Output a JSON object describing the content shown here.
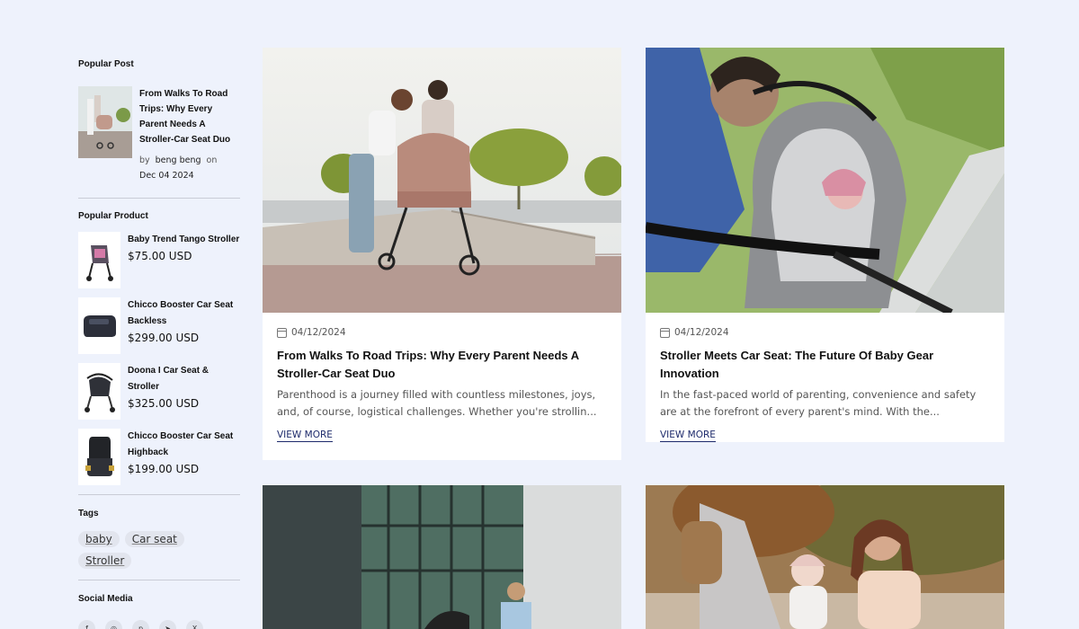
{
  "sidebar": {
    "popular_post": {
      "heading": "Popular Post",
      "item": {
        "title": "From Walks To Road Trips: Why Every Parent Needs A Stroller-Car Seat Duo",
        "by": "by",
        "author": "beng beng",
        "on": "on",
        "date": "Dec 04 2024"
      }
    },
    "popular_product": {
      "heading": "Popular Product",
      "items": [
        {
          "name": "Baby Trend Tango Stroller",
          "price": "$75.00 USD"
        },
        {
          "name": "Chicco Booster Car Seat Backless",
          "price": "$299.00 USD"
        },
        {
          "name": "Doona I Car Seat & Stroller",
          "price": "$325.00 USD"
        },
        {
          "name": "Chicco Booster Car Seat Highback",
          "price": "$199.00 USD"
        }
      ]
    },
    "tags": {
      "heading": "Tags",
      "items": [
        "baby",
        "Car seat",
        "Stroller"
      ]
    },
    "social": {
      "heading": "Social Media",
      "icons": [
        "facebook-icon",
        "instagram-icon",
        "pinterest-icon",
        "telegram-icon",
        "x-icon"
      ],
      "glyphs": [
        "f",
        "◎",
        "p",
        "➤",
        "X"
      ]
    }
  },
  "posts": [
    {
      "date": "04/12/2024",
      "title": "From Walks To Road Trips: Why Every Parent Needs A Stroller-Car Seat Duo",
      "excerpt": "Parenthood is a journey filled with countless milestones, joys, and, of course, logistical challenges. Whether you're strollin...",
      "more": "VIEW MORE"
    },
    {
      "date": "04/12/2024",
      "title": "Stroller Meets Car Seat: The Future Of Baby Gear Innovation",
      "excerpt": "In the fast-paced world of parenting, convenience and safety are at the forefront of every parent's mind. With the...",
      "more": "VIEW MORE"
    }
  ],
  "colors": {
    "background": "#eef2fc",
    "link": "#1d2a6b"
  }
}
